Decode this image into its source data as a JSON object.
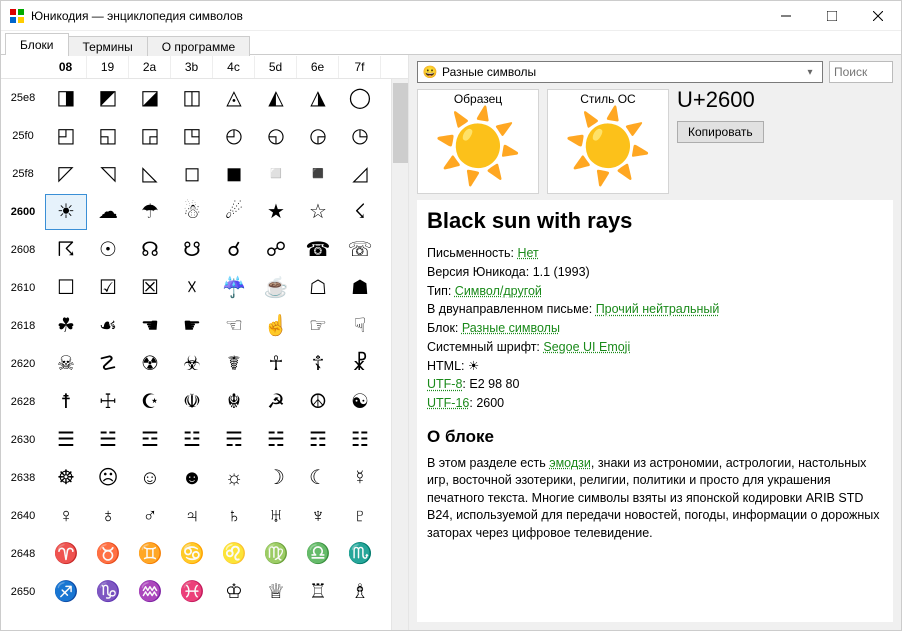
{
  "window": {
    "title": "Юникодия — энциклопедия символов"
  },
  "tabs": [
    {
      "label": "Блоки",
      "active": true
    },
    {
      "label": "Термины",
      "active": false
    },
    {
      "label": "О программе",
      "active": false
    }
  ],
  "grid": {
    "col_headers": [
      "08",
      "19",
      "2a",
      "3b",
      "4c",
      "5d",
      "6e",
      "7f"
    ],
    "active_col_index": 0,
    "active_row_index": 3,
    "rows": [
      {
        "label": "25e8",
        "cells": [
          "◨",
          "◩",
          "◪",
          "◫",
          "◬",
          "◭",
          "◮",
          "◯"
        ]
      },
      {
        "label": "25f0",
        "cells": [
          "◰",
          "◱",
          "◲",
          "◳",
          "◴",
          "◵",
          "◶",
          "◷"
        ]
      },
      {
        "label": "25f8",
        "cells": [
          "◸",
          "◹",
          "◺",
          "◻",
          "◼",
          "◽",
          "◾",
          "◿"
        ]
      },
      {
        "label": "2600",
        "cells": [
          "☀",
          "☁",
          "☂",
          "☃",
          "☄",
          "★",
          "☆",
          "☇"
        ]
      },
      {
        "label": "2608",
        "cells": [
          "☈",
          "☉",
          "☊",
          "☋",
          "☌",
          "☍",
          "☎",
          "☏"
        ]
      },
      {
        "label": "2610",
        "cells": [
          "☐",
          "☑",
          "☒",
          "☓",
          "☔",
          "☕",
          "☖",
          "☗"
        ]
      },
      {
        "label": "2618",
        "cells": [
          "☘",
          "☙",
          "☚",
          "☛",
          "☜",
          "☝",
          "☞",
          "☟"
        ]
      },
      {
        "label": "2620",
        "cells": [
          "☠",
          "☡",
          "☢",
          "☣",
          "☤",
          "☥",
          "☦",
          "☧"
        ]
      },
      {
        "label": "2628",
        "cells": [
          "☨",
          "☩",
          "☪",
          "☫",
          "☬",
          "☭",
          "☮",
          "☯"
        ]
      },
      {
        "label": "2630",
        "cells": [
          "☰",
          "☱",
          "☲",
          "☳",
          "☴",
          "☵",
          "☶",
          "☷"
        ]
      },
      {
        "label": "2638",
        "cells": [
          "☸",
          "☹",
          "☺",
          "☻",
          "☼",
          "☽",
          "☾",
          "☿"
        ]
      },
      {
        "label": "2640",
        "cells": [
          "♀",
          "♁",
          "♂",
          "♃",
          "♄",
          "♅",
          "♆",
          "♇"
        ]
      },
      {
        "label": "2648",
        "cells": [
          "♈",
          "♉",
          "♊",
          "♋",
          "♌",
          "♍",
          "♎",
          "♏"
        ]
      },
      {
        "label": "2650",
        "cells": [
          "♐",
          "♑",
          "♒",
          "♓",
          "♔",
          "♕",
          "♖",
          "♗"
        ]
      }
    ],
    "selected": {
      "row": 3,
      "col": 0
    }
  },
  "right": {
    "combo_text": "Разные символы",
    "combo_icon": "😀",
    "search_placeholder": "Поиск",
    "sample_label": "Образец",
    "os_style_label": "Стиль ОС",
    "codepoint": "U+2600",
    "copy_label": "Копировать",
    "glyph": "☀️"
  },
  "details": {
    "title": "Black sun with rays",
    "rows": [
      {
        "k": "Письменность",
        "v": "Нет",
        "link": true
      },
      {
        "k": "Версия Юникода",
        "v": "1.1 (1993)",
        "link": false
      },
      {
        "k": "Тип",
        "v": "Символ/другой",
        "link": true
      },
      {
        "k": "В двунаправленном письме",
        "v": "Прочий нейтральный",
        "link": true
      },
      {
        "k": "Блок",
        "v": "Разные символы",
        "link": true
      },
      {
        "k": "Системный шрифт",
        "v": "Segoe UI Emoji",
        "link": true
      },
      {
        "k": "HTML",
        "v": "&#9728;",
        "link": false
      },
      {
        "k": "UTF-8",
        "v": "E2 98 80",
        "link": false,
        "klink": true
      },
      {
        "k": "UTF-16",
        "v": "2600",
        "link": false,
        "klink": true
      }
    ],
    "about_heading": "О блоке",
    "about_text_pre": "В этом разделе есть ",
    "about_link": "эмодзи",
    "about_text_post": ", знаки из астрономии, астрологии, настольных игр, восточной эзотерики, религии, политики и просто для украшения печатного текста. Многие символы взяты из японской кодировки ARIB STD B24, используемой для передачи новостей, погоды, информации о дорожных заторах через цифровое телевидение."
  }
}
